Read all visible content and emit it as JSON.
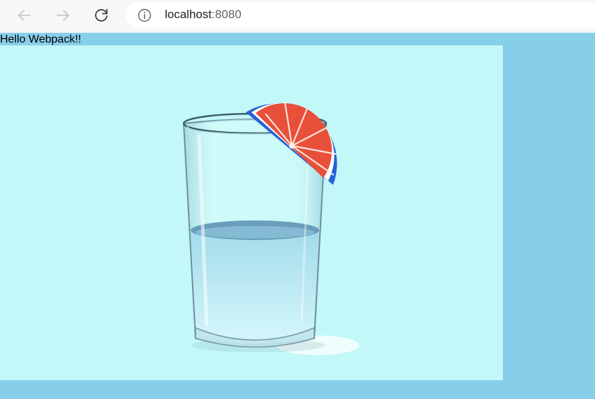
{
  "browser": {
    "back_icon": "arrow-left-icon",
    "forward_icon": "arrow-right-icon",
    "reload_icon": "reload-icon",
    "site_info_icon": "info-icon",
    "url_host": "localhost",
    "url_port": ":8080"
  },
  "page": {
    "heading_text": "Hello Webpack!!",
    "image": {
      "subject": "glass-of-water-with-grapefruit-slice",
      "background_color": "#c2f8f7"
    },
    "page_background": "#87CEEB"
  }
}
